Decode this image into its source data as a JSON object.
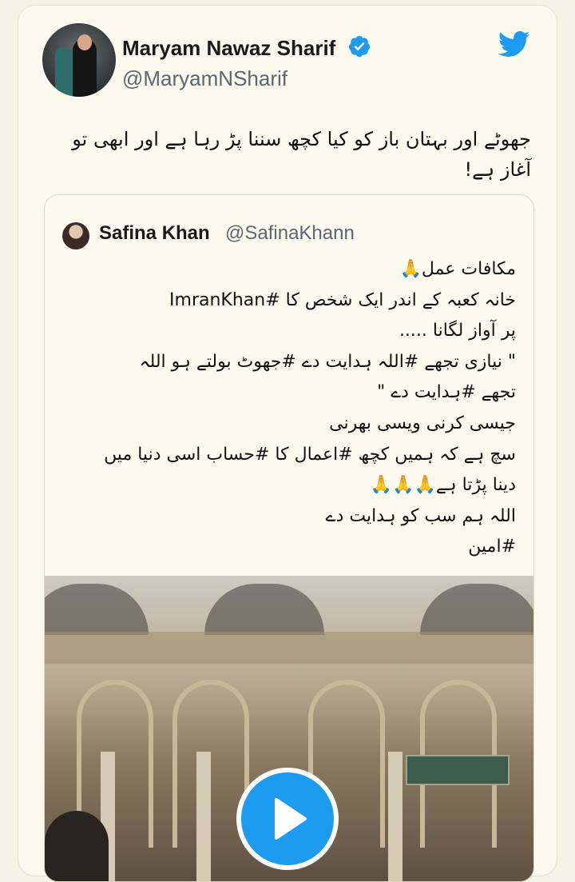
{
  "tweet": {
    "author_name": "Maryam Nawaz Sharif",
    "author_handle": "@MaryamNSharif",
    "text": "جھوٹے اور بہتان باز کو کیا کچھ سننا پڑ رہا ہے اور ابھی تو\nآغاز ہے!",
    "verified_icon": "verified-badge-icon",
    "platform_icon": "twitter-bird-icon",
    "colors": {
      "accent": "#1d9bf0",
      "text": "#111111",
      "secondary": "#5b6670"
    }
  },
  "quoted_tweet": {
    "author_name": "Safina Khan",
    "author_handle": "@SafinaKhann",
    "lines": [
      "مکافات عمل🙏",
      "خانہ کعبہ کے اندر ایک شخص کا #ImranKhan",
      "پر آواز لگانا .....",
      "\" نیازی تجھے #اللہ ہدایت دے #جھوٹ بولتے ہو اللہ",
      "تجھے #ہدایت دے \"",
      "جیسی کرنی ویسی بھرنی",
      "سچ ہے کہ ہمیں کچھ #اعمال کا #حساب اسی دنیا میں",
      "دینا پڑتا ہے🙏🙏🙏",
      "اللہ ہم سب کو ہدایت دے",
      "#امین"
    ],
    "media": {
      "type": "video",
      "control_icon": "play-icon"
    }
  }
}
